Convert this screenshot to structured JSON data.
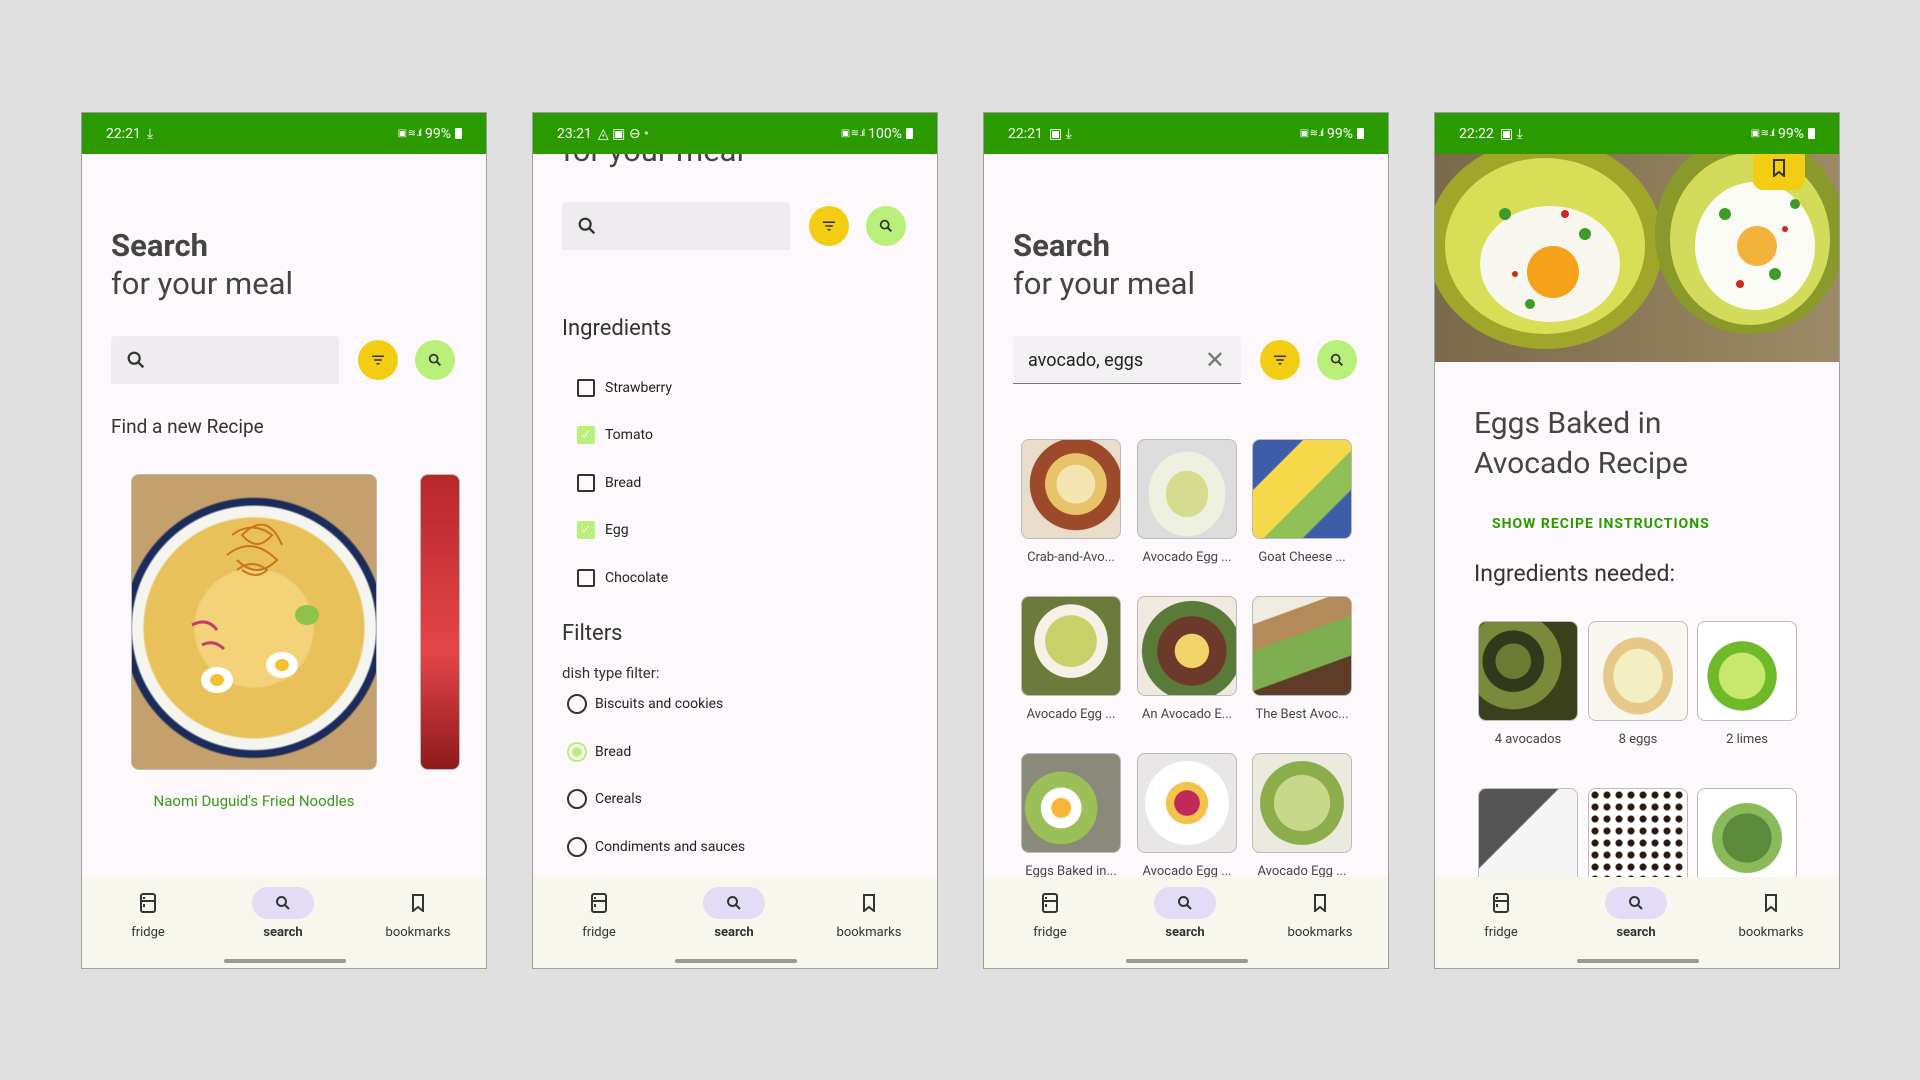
{
  "nav": {
    "fridge": "fridge",
    "search": "search",
    "bookmarks": "bookmarks"
  },
  "screen1": {
    "time": "22:21",
    "battery": "99%",
    "title": "Search",
    "subtitle": "for your meal",
    "section": "Find a new Recipe",
    "recipe_title": "Naomi Duguid's Fried Noodles"
  },
  "screen2": {
    "time": "23:21",
    "battery": "100%",
    "subtitle_partial": "for your meal",
    "ingredients_heading": "Ingredients",
    "ingredients": [
      {
        "label": "Strawberry",
        "checked": false
      },
      {
        "label": "Tomato",
        "checked": true
      },
      {
        "label": "Bread",
        "checked": false
      },
      {
        "label": "Egg",
        "checked": true
      },
      {
        "label": "Chocolate",
        "checked": false
      }
    ],
    "filters_heading": "Filters",
    "filter_label": "dish type filter:",
    "dish_types": [
      {
        "label": "Biscuits and cookies",
        "selected": false
      },
      {
        "label": "Bread",
        "selected": true
      },
      {
        "label": "Cereals",
        "selected": false
      },
      {
        "label": "Condiments and sauces",
        "selected": false
      }
    ]
  },
  "screen3": {
    "time": "22:21",
    "battery": "99%",
    "title": "Search",
    "subtitle": "for your meal",
    "search_value": "avocado, eggs",
    "results": [
      "Crab-and-Avo...",
      "Avocado Egg ...",
      "Goat Cheese ...",
      "Avocado Egg ...",
      "An Avocado E...",
      "The Best Avoc...",
      "Eggs Baked in...",
      "Avocado Egg ...",
      "Avocado Egg ..."
    ]
  },
  "screen4": {
    "time": "22:22",
    "battery": "99%",
    "recipe_title_l1": "Eggs Baked in",
    "recipe_title_l2": "Avocado Recipe",
    "show_instructions": "SHOW RECIPE INSTRUCTIONS",
    "ingredients_heading": "Ingredients needed:",
    "ingredients": [
      "4 avocados",
      "8 eggs",
      "2 limes"
    ]
  },
  "colors": {
    "status_bar": "#2a9a00",
    "accent_green": "#b8f07a",
    "accent_yellow": "#f2cd13",
    "link_green": "#3a9a1c"
  }
}
